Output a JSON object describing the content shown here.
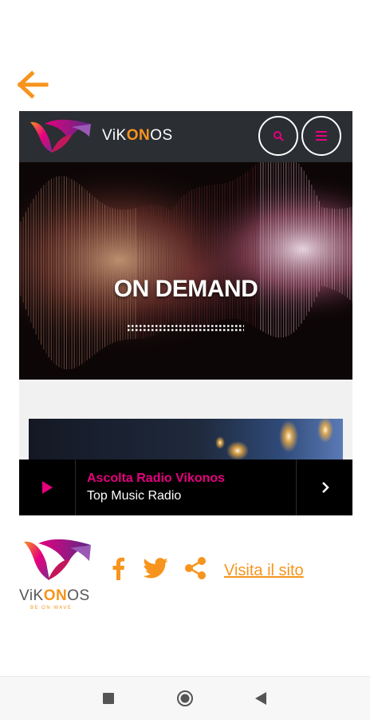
{
  "colors": {
    "accent": "#f7941d",
    "magenta": "#e6007e",
    "header_bg": "#2b2e33",
    "player_bg": "#000000"
  },
  "app": {
    "back_icon": "arrow-left-icon"
  },
  "site_header": {
    "brand_pre": "ViK",
    "brand_on": "ON",
    "brand_post": "OS",
    "search_icon": "search-icon",
    "menu_icon": "hamburger-menu-icon"
  },
  "hero": {
    "title": "ON DEMAND"
  },
  "player": {
    "title": "Ascolta Radio Vikonos",
    "subtitle": "Top Music Radio",
    "play_icon": "play-icon",
    "next_icon": "chevron-right-icon"
  },
  "footer": {
    "brand_pre": "ViK",
    "brand_on": "ON",
    "brand_post": "OS",
    "tagline": "BE ON WAVE",
    "visit_link": "Visita il sito",
    "social_icons": [
      "facebook-icon",
      "twitter-icon",
      "share-icon"
    ]
  },
  "system_nav": {
    "icons": [
      "recents-square-icon",
      "home-circle-icon",
      "back-triangle-icon"
    ]
  }
}
